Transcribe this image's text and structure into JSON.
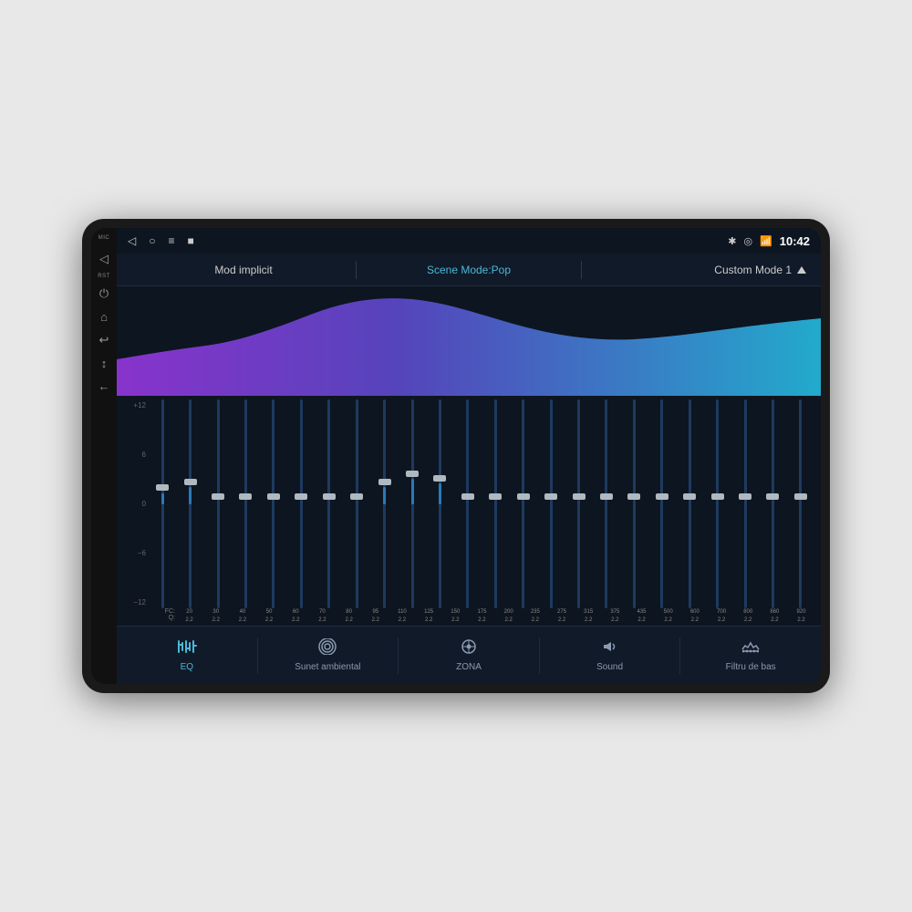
{
  "device": {
    "status_bar": {
      "mic_label": "MIC",
      "rst_label": "RST",
      "time": "10:42",
      "nav_back": "◁",
      "nav_home": "○",
      "nav_menu": "≡",
      "nav_recent": "■"
    },
    "mode_bar": {
      "mode1": "Mod implicit",
      "mode2": "Scene Mode:Pop",
      "mode3": "Custom Mode 1"
    },
    "eq": {
      "db_labels": [
        "+12",
        "6",
        "0",
        "-6",
        "-12"
      ],
      "bands": [
        {
          "fc": "20",
          "q": "2.2",
          "position": 0.45
        },
        {
          "fc": "30",
          "q": "2.2",
          "position": 0.42
        },
        {
          "fc": "40",
          "q": "2.2",
          "position": 0.5
        },
        {
          "fc": "50",
          "q": "2.2",
          "position": 0.5
        },
        {
          "fc": "60",
          "q": "2.2",
          "position": 0.5
        },
        {
          "fc": "70",
          "q": "2.2",
          "position": 0.5
        },
        {
          "fc": "80",
          "q": "2.2",
          "position": 0.5
        },
        {
          "fc": "95",
          "q": "2.2",
          "position": 0.5
        },
        {
          "fc": "110",
          "q": "2.2",
          "position": 0.42
        },
        {
          "fc": "125",
          "q": "2.2",
          "position": 0.38
        },
        {
          "fc": "150",
          "q": "2.2",
          "position": 0.4
        },
        {
          "fc": "175",
          "q": "2.2",
          "position": 0.5
        },
        {
          "fc": "200",
          "q": "2.2",
          "position": 0.5
        },
        {
          "fc": "235",
          "q": "2.2",
          "position": 0.5
        },
        {
          "fc": "275",
          "q": "2.2",
          "position": 0.5
        },
        {
          "fc": "315",
          "q": "2.2",
          "position": 0.5
        },
        {
          "fc": "375",
          "q": "2.2",
          "position": 0.5
        },
        {
          "fc": "435",
          "q": "2.2",
          "position": 0.5
        },
        {
          "fc": "500",
          "q": "2.2",
          "position": 0.5
        },
        {
          "fc": "600",
          "q": "2.2",
          "position": 0.5
        },
        {
          "fc": "700",
          "q": "2.2",
          "position": 0.5
        },
        {
          "fc": "800",
          "q": "2.2",
          "position": 0.5
        },
        {
          "fc": "860",
          "q": "2.2",
          "position": 0.5
        },
        {
          "fc": "920",
          "q": "2.2",
          "position": 0.5
        }
      ]
    },
    "bottom_nav": {
      "tabs": [
        {
          "id": "eq",
          "label": "EQ",
          "icon": "eq",
          "active": true
        },
        {
          "id": "ambient",
          "label": "Sunet ambiental",
          "icon": "radio",
          "active": false
        },
        {
          "id": "zona",
          "label": "ZONA",
          "icon": "target",
          "active": false
        },
        {
          "id": "sound",
          "label": "Sound",
          "icon": "sound",
          "active": false
        },
        {
          "id": "bass",
          "label": "Filtru de bas",
          "icon": "filter",
          "active": false
        }
      ]
    }
  }
}
